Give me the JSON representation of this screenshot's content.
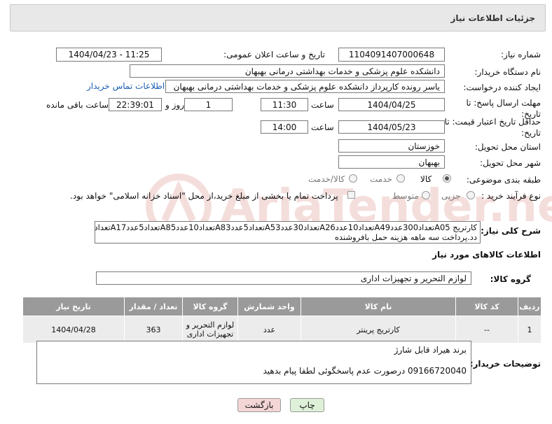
{
  "header": {
    "title": "جزئیات اطلاعات نیاز"
  },
  "form": {
    "need_number_label": "شماره نیاز:",
    "need_number": "1104091407000648",
    "announce_label": "تاریخ و ساعت اعلان عمومی:",
    "announce_value": "1404/04/23 - 11:25",
    "buyer_label": "نام دستگاه خریدار:",
    "buyer_value": "دانشکده علوم پزشکی و خدمات بهداشتی  درمانی بهبهان",
    "creator_label": "ایجاد کننده درخواست:",
    "creator_value": "یاسر رونده کارپرداز دانشکده علوم پزشکی و خدمات بهداشتی  درمانی بهبهان",
    "contact_link": "اطلاعات تماس خریدار",
    "deadline_label": "مهلت ارسال پاسخ: تا تاریخ:",
    "deadline_date": "1404/04/25",
    "time_label": "ساعت",
    "deadline_time": "11:30",
    "days_value": "1",
    "days_label": "روز و",
    "remaining_time": "22:39:01",
    "remaining_label": "ساعت باقی مانده",
    "validity_label": "حداقل تاریخ اعتبار قیمت: تا تاریخ:",
    "validity_date": "1404/05/23",
    "validity_time": "14:00",
    "province_label": "استان محل تحویل:",
    "province_value": "خوزستان",
    "city_label": "شهر محل تحویل:",
    "city_value": "بهبهان",
    "category_label": "طبقه بندی موضوعی:",
    "category_options": [
      "کالا",
      "خدمت",
      "کالا/خدمت"
    ],
    "category_selected": "کالا",
    "process_label": "نوع فرآیند خرید :",
    "process_options": [
      "جزیی",
      "متوسط"
    ],
    "process_selected": "جزیی",
    "payment_note": "پرداخت تمام یا بخشی از مبلغ خرید،از محل \"اسناد خزانه اسلامی\" خواهد بود.",
    "description_label": "شرح کلی نیاز:",
    "description_line1": "کارتریج A05تعداد300عددA49تعداد10عددA26تعداد30عددA53تعداد5عددA83تعداد10عددA85تعداد5عددA17تعداد3ع",
    "description_line2": "دد.پرداخت سه ماهه هزینه حمل بافروشنده"
  },
  "goods": {
    "section_title": "اطلاعات کالاهای مورد نیاز",
    "group_label": "گروه کالا:",
    "group_value": "لوازم التحریر و تجهیزات اداری",
    "table": {
      "headers": [
        "ردیف",
        "کد کالا",
        "نام کالا",
        "واحد شمارش",
        "گروه کالا",
        "تعداد / مقدار",
        "تاریخ نیاز"
      ],
      "rows": [
        [
          "1",
          "--",
          "کارتریج پرینتر",
          "عدد",
          "لوازم التحریر و تجهیزات اداری",
          "363",
          "1404/04/28"
        ]
      ]
    }
  },
  "buyer_notes": {
    "label": "توضیحات خریدار:",
    "line1": "برند هیراد قابل شارژ",
    "line2": "09166720040 درصورت عدم پاسخگوئی لطفا پیام بدهید"
  },
  "buttons": {
    "print": "چاپ",
    "back": "بازگشت"
  },
  "watermark": {
    "text": "AriaTender.neT"
  },
  "colors": {
    "header_bg": "#e8e8e8",
    "table_header": "#9a9a9a",
    "link": "#1a5fb4",
    "print_btn": "#dff0d8",
    "back_btn": "#f4d6d6"
  }
}
